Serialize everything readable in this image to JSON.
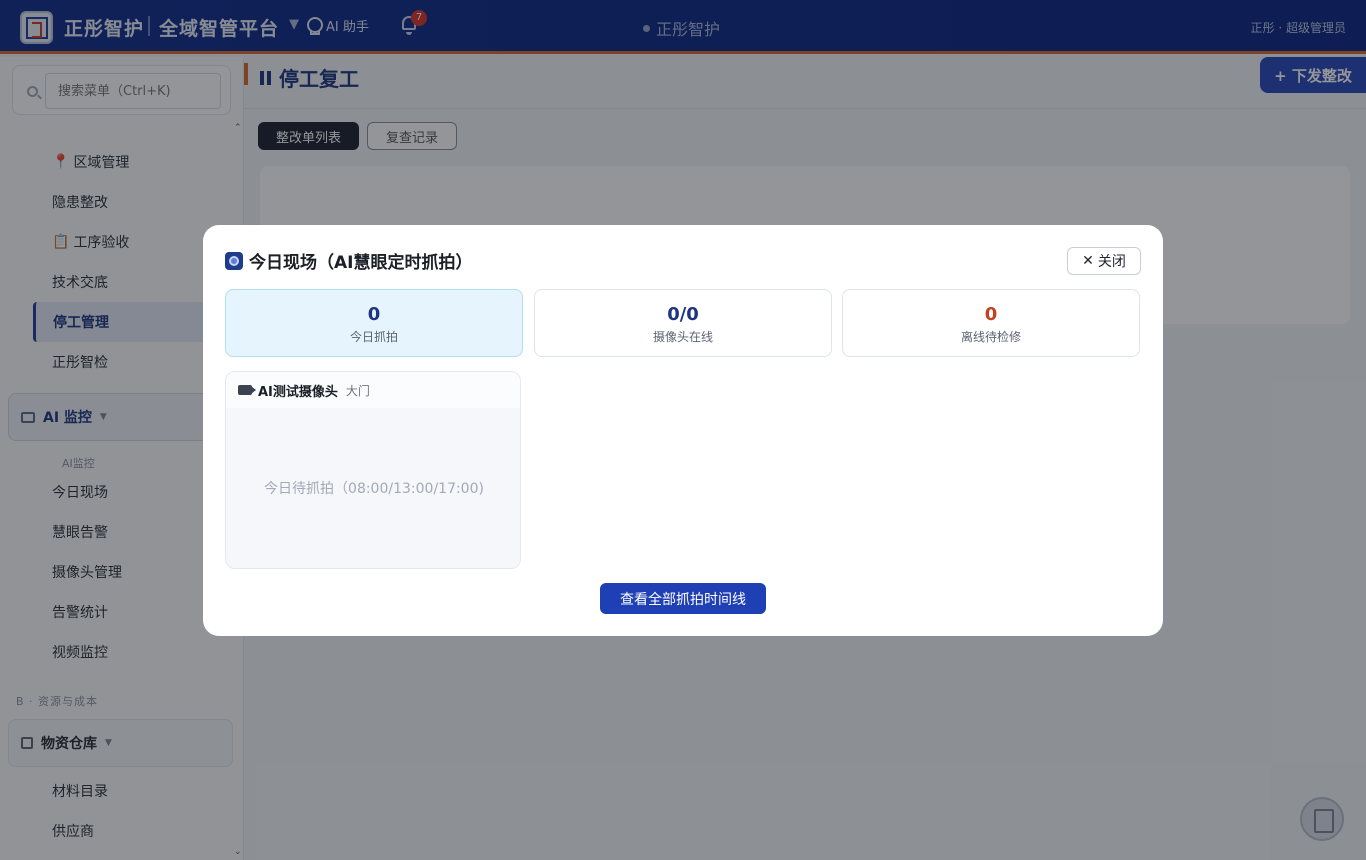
{
  "header": {
    "brand": "正彤智护",
    "platform": "全域智管平台",
    "ai_assistant": "AI 助手",
    "notification_count": "7",
    "center_title": "正彤智护",
    "user": "正彤 · 超级管理员"
  },
  "sidebar": {
    "search_placeholder": "搜索菜单（Ctrl+K)",
    "items": [
      {
        "label": "区域管理",
        "icon": "pin-icon"
      },
      {
        "label": "隐患整改"
      },
      {
        "label": "工序验收",
        "icon": "clipboard-icon"
      },
      {
        "label": "技术交底"
      },
      {
        "label": "停工管理",
        "active": true
      },
      {
        "label": "正彤智检"
      }
    ],
    "ai_group": {
      "label": "AI 监控",
      "sub_label": "AI监控"
    },
    "ai_items": [
      "今日现场",
      "慧眼告警",
      "摄像头管理",
      "告警统计",
      "视频监控"
    ],
    "section_b": "B · 资源与成本",
    "warehouse_group": {
      "label": "物资仓库"
    },
    "warehouse_items": [
      "材料目录",
      "供应商"
    ]
  },
  "page": {
    "title": "停工复工",
    "issue_button": "+ 下发整改",
    "tabs": [
      "整改单列表",
      "复查记录"
    ]
  },
  "modal": {
    "title": "今日现场（AI慧眼定时抓拍）",
    "close": "关闭",
    "stats": [
      {
        "value": "0",
        "label": "今日抓拍"
      },
      {
        "value": "0/0",
        "label": "摄像头在线"
      },
      {
        "value": "0",
        "label": "离线待检修"
      }
    ],
    "camera": {
      "name": "AI测试摄像头",
      "location": "大门",
      "status": "今日待抓拍（08:00/13:00/17:00)"
    },
    "timeline_button": "查看全部抓拍时间线"
  },
  "colors": {
    "primary": "#1d347f",
    "accent": "#d9682a",
    "danger": "#c2411f",
    "badge": "#d9302b"
  }
}
